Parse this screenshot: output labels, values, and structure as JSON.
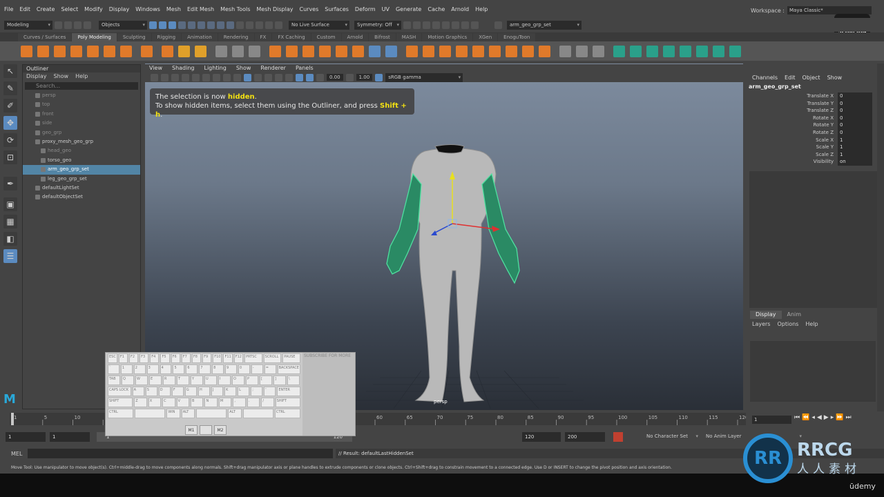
{
  "menubar": {
    "items": [
      "File",
      "Edit",
      "Create",
      "Select",
      "Modify",
      "Display",
      "Windows",
      "Mesh",
      "Edit Mesh",
      "Mesh Tools",
      "Mesh Display",
      "Curves",
      "Surfaces",
      "Deform",
      "UV",
      "Generate",
      "Cache",
      "Arnold",
      "Help"
    ]
  },
  "workspace": {
    "label": "Workspace :",
    "value": "Maya Classic*"
  },
  "statusline": {
    "mode": "Modeling",
    "objects": "Objects",
    "live_surface": "No Live Surface",
    "symmetry": "Symmetry: Off",
    "selection_field": "arm_geo_grp_set"
  },
  "shelf_tabs": [
    "Curves / Surfaces",
    "Poly Modeling",
    "Sculpting",
    "Rigging",
    "Animation",
    "Rendering",
    "FX",
    "FX Caching",
    "Custom",
    "Arnold",
    "Bifrost",
    "MASH",
    "Motion Graphics",
    "XGen",
    "EnoguToon"
  ],
  "shelf_tab_active": "Poly Modeling",
  "outliner": {
    "title": "Outliner",
    "menus": [
      "Display",
      "Show",
      "Help"
    ],
    "search_placeholder": "Search...",
    "rows": [
      {
        "label": "persp",
        "state": "dim",
        "indent": 28
      },
      {
        "label": "top",
        "state": "dim",
        "indent": 28
      },
      {
        "label": "front",
        "state": "dim",
        "indent": 28
      },
      {
        "label": "side",
        "state": "dim",
        "indent": 28
      },
      {
        "label": "geo_grp",
        "state": "dim",
        "indent": 28
      },
      {
        "label": "proxy_mesh_geo_grp",
        "state": "normal",
        "indent": 28
      },
      {
        "label": "head_geo",
        "state": "dim",
        "indent": 36
      },
      {
        "label": "torso_geo",
        "state": "normal",
        "indent": 36
      },
      {
        "label": "arm_geo_grp_set",
        "state": "sel",
        "indent": 36
      },
      {
        "label": "leg_geo_grp_set",
        "state": "normal",
        "indent": 36
      },
      {
        "label": "defaultLightSet",
        "state": "normal",
        "indent": 28
      },
      {
        "label": "defaultObjectSet",
        "state": "normal",
        "indent": 28
      }
    ]
  },
  "viewport": {
    "menus": [
      "View",
      "Shading",
      "Lighting",
      "Show",
      "Renderer",
      "Panels"
    ],
    "exposure": "0.00",
    "gamma": "1.00",
    "color_space": "sRGB gamma",
    "camera": "persp"
  },
  "hud": {
    "line1_pre": "The selection is now ",
    "line1_hl": "hidden",
    "line1_post": ".",
    "line2_pre": "To show hidden items, select them using the Outliner, and press ",
    "line2_hl": "Shift + h",
    "line2_post": "."
  },
  "channelbox": {
    "menus": [
      "Channels",
      "Edit",
      "Object",
      "Show"
    ],
    "object": "arm_geo_grp_set",
    "attrs": [
      {
        "name": "Translate X",
        "value": "0"
      },
      {
        "name": "Translate Y",
        "value": "0"
      },
      {
        "name": "Translate Z",
        "value": "0"
      },
      {
        "name": "Rotate X",
        "value": "0"
      },
      {
        "name": "Rotate Y",
        "value": "0"
      },
      {
        "name": "Rotate Z",
        "value": "0"
      },
      {
        "name": "Scale X",
        "value": "1"
      },
      {
        "name": "Scale Y",
        "value": "1"
      },
      {
        "name": "Scale Z",
        "value": "1"
      },
      {
        "name": "Visibility",
        "value": "on"
      }
    ]
  },
  "layers": {
    "tabs": [
      "Display",
      "Anim"
    ],
    "active": "Display",
    "menus": [
      "Layers",
      "Options",
      "Help"
    ]
  },
  "timeline": {
    "ticks": [
      "1",
      "5",
      "10",
      "15",
      "20",
      "25",
      "30",
      "35",
      "40",
      "45",
      "50",
      "55",
      "60",
      "65",
      "70",
      "75",
      "80",
      "85",
      "90",
      "95",
      "100",
      "105",
      "110",
      "115",
      "120"
    ],
    "current_frame": "1"
  },
  "range": {
    "start": "1",
    "start2": "1",
    "slider_start": "1",
    "slider_end": "120",
    "end": "120",
    "end2": "200",
    "char_set": "No Character Set",
    "anim_layer": "No Anim Layer"
  },
  "cmd": {
    "label": "MEL",
    "result": "// Result: defaultLastHiddenSet"
  },
  "helpline": "Move Tool: Use manipulator to move object(s). Ctrl+middle-drag to move components along normals. Shift+drag manipulator axis or plane handles to extrude components or clone objects. Ctrl+Shift+drag to constrain movement to a connected edge. Use D or INSERT to change the pivot position and axis orientation.",
  "overlay": {
    "subscribe": "SUBSCRIBE FOR MORE",
    "mouse": [
      "M1",
      "",
      "M2"
    ],
    "rrcg": "RRCG",
    "rrcg_sub": "人人素材",
    "udemy": "ūdemy",
    "scorpion": "SCORPION",
    "keys": {
      "row0": [
        "ESC",
        "F1",
        "F2",
        "F3",
        "F4",
        "F5",
        "F6",
        "F7",
        "F8",
        "F9",
        "F10",
        "F11",
        "F12",
        "PRTSC",
        "SCROLL",
        "PAUSE"
      ],
      "row1": [
        "`",
        "1",
        "2",
        "3",
        "4",
        "5",
        "6",
        "7",
        "8",
        "9",
        "0",
        "-",
        "=",
        "BACKSPACE"
      ],
      "row2": [
        "TAB",
        "Q",
        "W",
        "E",
        "R",
        "T",
        "Y",
        "U",
        "I",
        "O",
        "P",
        "[",
        "]",
        "\\"
      ],
      "row3": [
        "CAPS LOCK",
        "A",
        "S",
        "D",
        "F",
        "G",
        "H",
        "J",
        "K",
        "L",
        ";",
        "'",
        "ENTER"
      ],
      "row4": [
        "SHIFT",
        "Z",
        "X",
        "C",
        "V",
        "B",
        "N",
        "M",
        ",",
        ".",
        "/",
        "SHIFT"
      ],
      "row5": [
        "CTRL",
        "",
        "WIN",
        "ALT",
        "",
        "ALT",
        "",
        "CTRL"
      ]
    }
  },
  "colors": {
    "selection": "#5285a6",
    "wire": "#4fe0a0",
    "accent": "#5b8bc0"
  }
}
